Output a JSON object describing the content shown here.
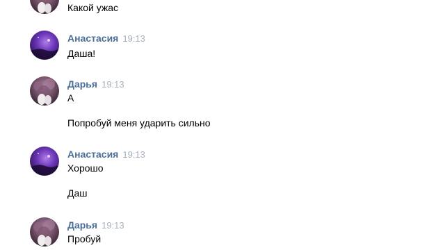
{
  "colors": {
    "author_name": "#4a6e96",
    "timestamp": "#a6b0bc",
    "message_text": "#000000",
    "background": "#ffffff"
  },
  "messages": [
    {
      "author": "",
      "time": "",
      "avatar": "darya-avatar",
      "texts": [
        "Какой ужас"
      ]
    },
    {
      "author": "Анастасия",
      "time": "19:13",
      "avatar": "anastasia-avatar",
      "texts": [
        "Даша!"
      ]
    },
    {
      "author": "Дарья",
      "time": "19:13",
      "avatar": "darya-avatar",
      "texts": [
        "А",
        "Попробуй меня ударить сильно"
      ]
    },
    {
      "author": "Анастасия",
      "time": "19:13",
      "avatar": "anastasia-avatar",
      "texts": [
        "Хорошо",
        "Даш"
      ]
    },
    {
      "author": "Дарья",
      "time": "19:13",
      "avatar": "darya-avatar",
      "texts": [
        "Пробуй"
      ]
    }
  ]
}
